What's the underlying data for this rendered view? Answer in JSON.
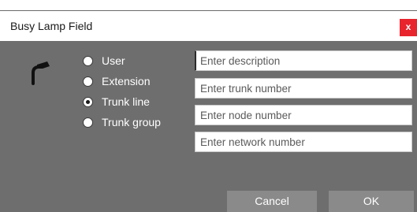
{
  "dialog": {
    "title": "Busy Lamp Field",
    "close_label": "x"
  },
  "options": [
    {
      "label": "User",
      "selected": false
    },
    {
      "label": "Extension",
      "selected": false
    },
    {
      "label": "Trunk line",
      "selected": true
    },
    {
      "label": "Trunk group",
      "selected": false
    }
  ],
  "fields": {
    "description_placeholder": "Enter description",
    "trunk_number_placeholder": "Enter trunk number",
    "node_number_placeholder": "Enter node number",
    "network_number_placeholder": "Enter network number"
  },
  "buttons": {
    "cancel": "Cancel",
    "ok": "OK"
  },
  "icons": {
    "handset": "telephone-handset-icon",
    "close": "close-icon"
  },
  "colors": {
    "close_bg": "#e8242d",
    "dialog_bg": "#6e6e6e",
    "button_bg": "#8a8a8a"
  }
}
